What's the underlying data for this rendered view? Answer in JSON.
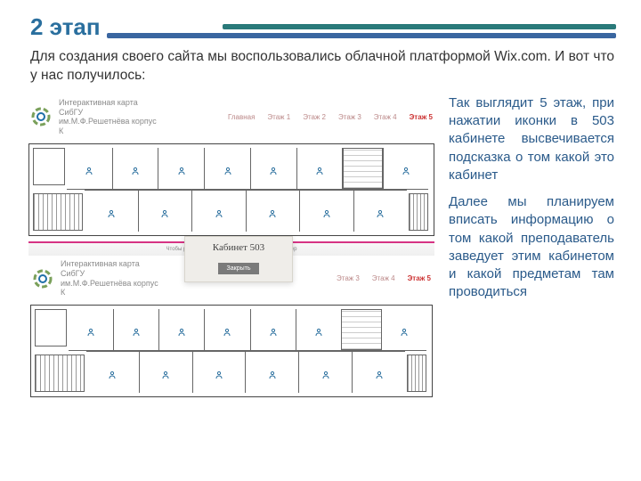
{
  "title": "2 этап",
  "intro": "Для создания своего сайта мы воспользовались облачной платформой Wix.com. И вот что у нас получилось:",
  "site": {
    "name_l1": "Интерактивная карта СибГУ",
    "name_l2": "им.М.Ф.Решетнёва корпус К",
    "tabs": [
      "Главная",
      "Этаж 1",
      "Этаж 2",
      "Этаж 3",
      "Этаж 4",
      "Этаж 5"
    ],
    "active_tab": 5
  },
  "modal": {
    "title": "Кабинет 503",
    "button": "Закрыть",
    "bar_hint": "Чтобы редактировать сайт, перейдите на компьютер"
  },
  "right": {
    "p1": "Так выглядит 5 этаж, при нажатии иконки в 503 кабинете высвечивается подсказка о том какой это кабинет",
    "p2": "Далее мы планируем вписать информацию о том какой преподаватель заведует этим кабинетом и какой предметам там проводиться"
  }
}
